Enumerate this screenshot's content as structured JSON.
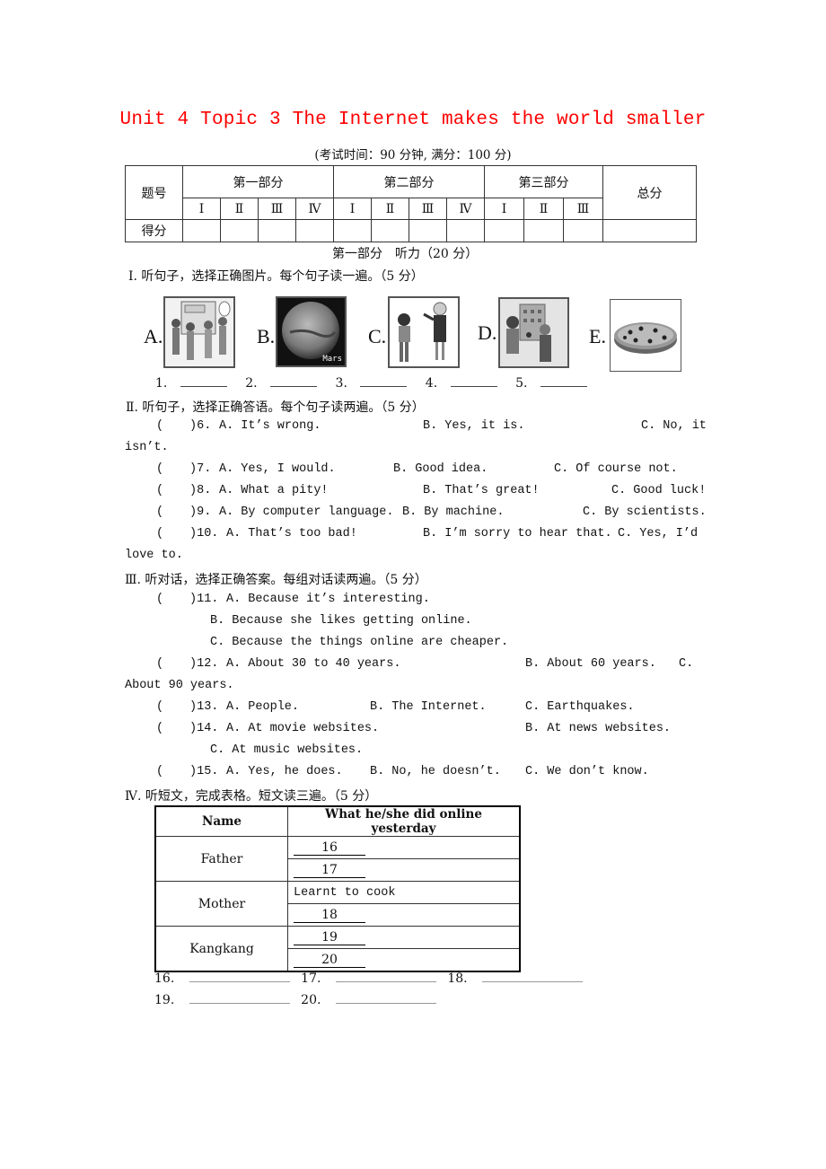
{
  "header": {
    "title": "Unit 4 Topic 3 The Internet makes the world smaller",
    "title_color": "#ff0000",
    "subtitle": "(考试时间：90 分钟, 满分：100 分)"
  },
  "score_table": {
    "row_label_question": "题号",
    "row_label_score": "得分",
    "parts": [
      {
        "label": "第一部分",
        "subs": [
          "Ⅰ",
          "Ⅱ",
          "Ⅲ",
          "Ⅳ"
        ]
      },
      {
        "label": "第二部分",
        "subs": [
          "Ⅰ",
          "Ⅱ",
          "Ⅲ",
          "Ⅳ"
        ]
      },
      {
        "label": "第三部分",
        "subs": [
          "Ⅰ",
          "Ⅱ",
          "Ⅲ"
        ]
      }
    ],
    "total_label": "总分"
  },
  "part1": {
    "heading": "第一部分　听力（20 分）",
    "section1": {
      "instruction": "Ⅰ. 听句子，选择正确图片。每个句子读一遍。（5 分）",
      "pictures": [
        {
          "label": "A.",
          "desc": "students-at-english-corner-icon"
        },
        {
          "label": "B.",
          "desc": "mars-planet-icon",
          "caption": "Mars"
        },
        {
          "label": "C.",
          "desc": "boy-and-woman-talking-icon"
        },
        {
          "label": "D.",
          "desc": "reporter-interview-icon"
        },
        {
          "label": "E.",
          "desc": "pizza-icon"
        }
      ],
      "blanks": [
        "1.",
        "2.",
        "3.",
        "4.",
        "5."
      ]
    },
    "section2": {
      "instruction": "Ⅱ. 听句子，选择正确答语。每个句子读两遍。（5 分）",
      "q6": {
        "num": ")6.",
        "a": "A.  It’s wrong.",
        "b": "B.  Yes, it is.",
        "c": "C. No, it",
        "cont": "isn’t."
      },
      "q7": {
        "num": ")7.",
        "a": "A.  Yes, I would.",
        "b": "B.  Good idea.",
        "c": "C.  Of course not."
      },
      "q8": {
        "num": ")8.",
        "a": "A.  What a pity!",
        "b": "B.  That’s great!",
        "c": "C. Good luck!"
      },
      "q9": {
        "num": ")9.",
        "a": "A.  By computer language.",
        "b": "B.  By machine.",
        "c": "C. By scientists."
      },
      "q10": {
        "num": ")10.",
        "a": "A.  That’s too bad!",
        "b": "B. I’m sorry to hear that.",
        "c": "C. Yes, I’d",
        "cont": "love to."
      }
    },
    "section3": {
      "instruction": "Ⅲ. 听对话，选择正确答案。每组对话读两遍。（5 分）",
      "q11": {
        "num": ")11.",
        "a": "A.  Because it’s interesting.",
        "b": "B.  Because she likes getting online.",
        "c": "C.  Because the things online are cheaper."
      },
      "q12": {
        "num": ")12.",
        "a": "A.  About 30 to 40 years.",
        "b": "B.  About 60 years.",
        "c": "C.",
        "cont": "About 90 years."
      },
      "q13": {
        "num": ")13.",
        "a": "A.  People.",
        "b": "B.  The Internet.",
        "c": "C.  Earthquakes."
      },
      "q14": {
        "num": ")14.",
        "a": "A.  At movie websites.",
        "b": "B.   At   news   websites.",
        "c": "C.  At music websites."
      },
      "q15": {
        "num": ")15.",
        "a": "A.  Yes, he does.",
        "b": "B.  No, he doesn’t.",
        "c": "C.  We don’t know."
      }
    },
    "section4": {
      "instruction": "Ⅳ. 听短文，完成表格。短文读三遍。（5 分）",
      "table": {
        "col_name": "Name",
        "col_action": "What he/she did online yesterday",
        "rows": [
          {
            "name": "Father",
            "items": [
              "16",
              "17"
            ]
          },
          {
            "name": "Mother",
            "items": [
              "Learnt to cook",
              "18"
            ]
          },
          {
            "name": "Kangkang",
            "items": [
              "19",
              "20"
            ]
          }
        ]
      },
      "answer_blanks": [
        "16.",
        "17.",
        "18.",
        "19.",
        "20."
      ]
    }
  },
  "paren_open": "("
}
